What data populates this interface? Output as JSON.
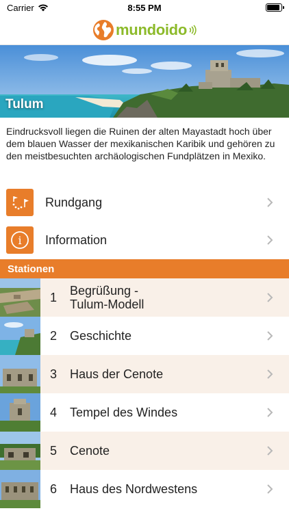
{
  "status": {
    "carrier": "Carrier",
    "time": "8:55 PM",
    "battery_level": 0.9
  },
  "header": {
    "logo_text": "mundoido",
    "logo_icon": "globe-icon"
  },
  "hero": {
    "title": "Tulum"
  },
  "description": "Eindrucksvoll liegen die Ruinen der alten Mayastadt hoch über dem blauen Wasser der mexikanischen Karibik und gehören zu den meistbesuchten archäologischen Fundplätzen in Mexiko.",
  "menu": [
    {
      "label": "Rundgang",
      "icon": "route-map-icon"
    },
    {
      "label": "Information",
      "icon": "info-icon"
    }
  ],
  "stations_header": "Stationen",
  "stations": [
    {
      "num": "1",
      "title_line1": "Begrüßung -",
      "title_line2": "Tulum-Modell"
    },
    {
      "num": "2",
      "title_line1": "Geschichte"
    },
    {
      "num": "3",
      "title_line1": "Haus der Cenote"
    },
    {
      "num": "4",
      "title_line1": "Tempel des Windes"
    },
    {
      "num": "5",
      "title_line1": "Cenote"
    },
    {
      "num": "6",
      "title_line1": "Haus des Nordwestens"
    }
  ],
  "colors": {
    "accent": "#e87d2a",
    "logo_green": "#8cba2a",
    "row_alt": "#f9f0e8"
  }
}
